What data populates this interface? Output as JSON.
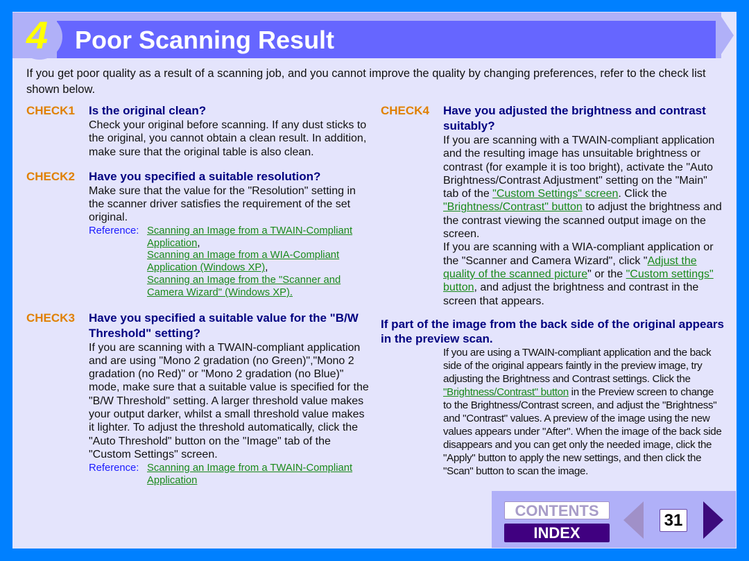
{
  "header": {
    "chapter_number": "4",
    "title": "Poor Scanning Result"
  },
  "intro": "If you get poor quality as a result of a scanning job, and you cannot improve the quality by changing preferences, refer to the check list shown below.",
  "checks": [
    {
      "label": "CHECK1",
      "title": "Is the original clean?",
      "body": "Check your original before scanning. If any dust sticks to the original, you cannot obtain a clean result. In addition, make sure that the original table is also clean."
    },
    {
      "label": "CHECK2",
      "title": "Have you specified a suitable resolution?",
      "body": "Make sure that the value for the \"Resolution\" setting in the scanner driver satisfies the requirement of the set original.",
      "reference_label": "Reference:",
      "references": [
        {
          "link": "Scanning an Image from a TWAIN-Compliant Application",
          "suffix": ","
        },
        {
          "link": "Scanning an Image from a WIA-Compliant Application (Windows XP)",
          "suffix": ","
        },
        {
          "link": "Scanning an Image from the \"Scanner and Camera Wizard\" (Windows XP).",
          "suffix": ""
        }
      ]
    },
    {
      "label": "CHECK3",
      "title": "Have you specified a suitable value for the \"B/W Threshold\" setting?",
      "body": "If you are scanning with a TWAIN-compliant application and are using \"Mono 2 gradation (no Green)\",\"Mono 2 gradation (no Red)\" or \"Mono 2 gradation (no Blue)\" mode, make sure that a suitable value is specified for the \"B/W Threshold\" setting. A larger threshold value makes your output darker, whilst a small threshold value makes it lighter. To adjust the threshold automatically, click the \"Auto Threshold\" button on the \"Image\" tab of the \"Custom Settings\" screen.",
      "reference_label": "Reference:",
      "references": [
        {
          "link": "Scanning an Image from a TWAIN-Compliant Application",
          "suffix": ""
        }
      ]
    },
    {
      "label": "CHECK4",
      "title": "Have you adjusted the brightness and contrast suitably?",
      "p1_a": "If you are scanning with a TWAIN-compliant application and the resulting image has unsuitable brightness or contrast (for example it is too bright), activate the \"Auto Brightness/Contrast Adjustment\" setting on the \"Main\" tab of the ",
      "p1_link1": "\"Custom Settings\" screen",
      "p1_b": ". Click the ",
      "p1_link2": "\"Brightness/Contrast\" button",
      "p1_c": " to adjust the brightness and the contrast viewing the scanned output image on the screen.",
      "p2_a": "If you are scanning with a WIA-compliant application or the \"Scanner and Camera Wizard\", click \"",
      "p2_link1": "Adjust the quality of the scanned picture",
      "p2_b": "\" or the ",
      "p2_link2": "\"Custom settings\" button",
      "p2_c": ", and adjust the brightness and contrast in the screen that appears."
    }
  ],
  "backside": {
    "title": "If part of the image from the back side of the original appears in the preview scan.",
    "a": "If you are using a TWAIN-compliant application and the back side of the original appears faintly in the preview image, try adjusting the Brightness and Contrast settings. Click the ",
    "link": "\"Brightness/Contrast\" button",
    "b": " in the Preview screen to change to the Brightness/Contrast screen, and adjust the \"Brightness\" and \"Contrast\" values. A preview of the image using the new values appears under \"After\". When the image of the back side disappears and you can get only the needed image, click the \"Apply\" button to apply the new settings, and then click the \"Scan\" button to scan the image."
  },
  "nav": {
    "contents_label": "CONTENTS",
    "index_label": "INDEX",
    "page_number": "31",
    "prev_icon": "previous-page-arrow",
    "next_icon": "next-page-arrow"
  },
  "colors": {
    "frame": "#0080ff",
    "page": "#e4e4fc",
    "header_bar": "#6666ff",
    "check_label": "#e08000",
    "check_title": "#000080",
    "link": "#1a8a1a",
    "reference_label": "#1a1aff",
    "index_button": "#400080"
  }
}
